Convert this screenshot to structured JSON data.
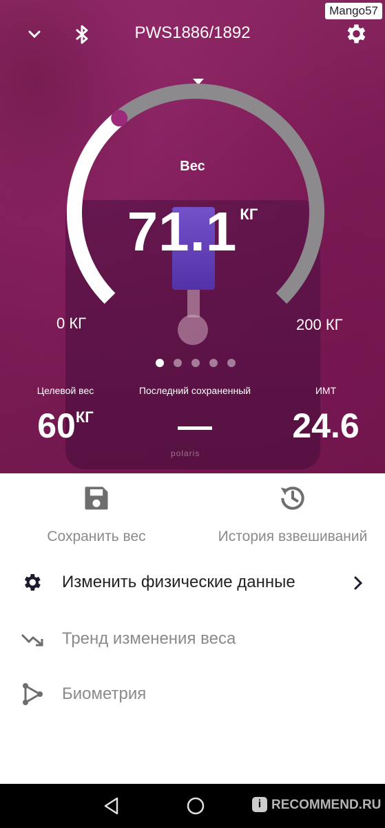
{
  "watermark": "Mango57",
  "header": {
    "title": "PWS1886/1892",
    "icons": [
      "chevron-down-icon",
      "bluetooth-icon",
      "gear-icon"
    ]
  },
  "gauge": {
    "label": "Вес",
    "value": "71.1",
    "unit": "КГ",
    "min_label": "0 КГ",
    "max_label": "200 КГ",
    "min": 0,
    "max": 200,
    "current": 71.1,
    "fill_fraction": 0.355,
    "accent_color": "#9b2a7a"
  },
  "pager": {
    "count": 5,
    "active": 0
  },
  "stats": {
    "target": {
      "label": "Целевой вес",
      "value": "60",
      "unit": "КГ"
    },
    "last_saved": {
      "label": "Последний сохраненный",
      "value": "—"
    },
    "bmi": {
      "label": "ИМТ",
      "value": "24.6"
    }
  },
  "scale_brand": "polaris",
  "actions": {
    "save": {
      "label": "Сохранить вес",
      "icon": "floppy-disk-icon"
    },
    "history": {
      "label": "История взвешиваний",
      "icon": "history-icon"
    }
  },
  "menu": {
    "items": [
      {
        "label": "Изменить физические данные",
        "icon": "gear-icon"
      },
      {
        "label": "Тренд изменения веса",
        "icon": "trending-down-icon"
      },
      {
        "label": "Биометрия",
        "icon": "biometry-icon"
      }
    ]
  },
  "navbar": {
    "watermark": "RECOMMEND.RU",
    "badge": "i"
  }
}
